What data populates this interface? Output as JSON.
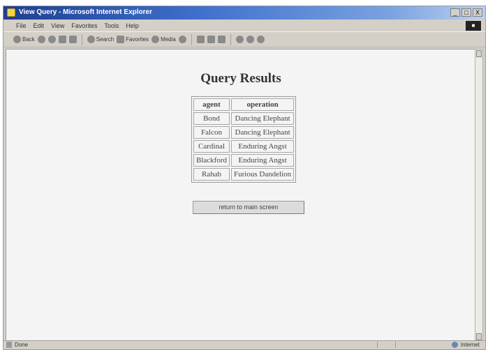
{
  "window": {
    "title": "View Query - Microsoft Internet Explorer",
    "controls": {
      "minimize": "_",
      "maximize": "□",
      "close": "X"
    }
  },
  "menu": [
    "File",
    "Edit",
    "View",
    "Favorites",
    "Tools",
    "Help"
  ],
  "toolbar": {
    "back": "Back",
    "search": "Search",
    "favorites": "Favorites",
    "media": "Media"
  },
  "page": {
    "heading": "Query Results",
    "table": {
      "headers": [
        "agent",
        "operation"
      ],
      "rows": [
        [
          "Bond",
          "Dancing Elephant"
        ],
        [
          "Falcon",
          "Dancing Elephant"
        ],
        [
          "Cardinal",
          "Enduring Angst"
        ],
        [
          "Blackford",
          "Enduring Angst"
        ],
        [
          "Rahab",
          "Furious Dandelion"
        ]
      ]
    },
    "return_button": "return to main screen"
  },
  "status": {
    "left": "Done",
    "zone": "Internet"
  }
}
